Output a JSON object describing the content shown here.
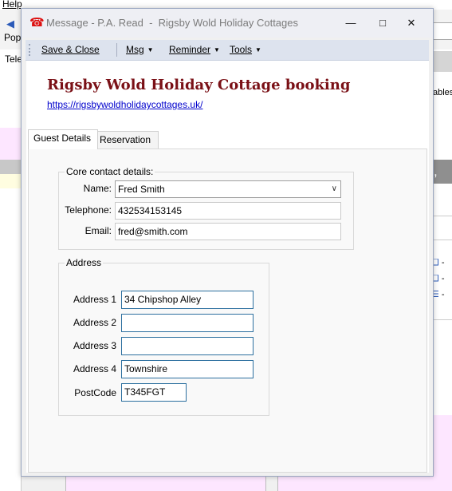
{
  "background": {
    "menu_help": "Help",
    "ribbon_label": "Pop",
    "left_tab": "Tele",
    "right_text": "ables",
    "right_header": ", wh",
    "right_dash": "-"
  },
  "window": {
    "title": "Message - P.A. Read  -  Rigsby Wold Holiday Cottages",
    "minimize": "—",
    "maximize": "□",
    "close": "✕"
  },
  "toolbar": {
    "save_close": "Save & Close",
    "msg": "Msg",
    "reminder": "Reminder",
    "tools": "Tools"
  },
  "form": {
    "heading": "Rigsby Wold Holiday Cottage booking",
    "link": "https://rigsbywoldholidaycottages.uk/",
    "tabs": [
      "Guest Details",
      "Reservation"
    ],
    "contact": {
      "legend": "Core contact details:",
      "name_label": "Name:",
      "name_value": "Fred Smith",
      "telephone_label": "Telephone:",
      "telephone_value": "432534153145",
      "email_label": "Email:",
      "email_value": "fred@smith.com"
    },
    "address": {
      "legend": "Address",
      "rows": [
        {
          "label": "Address 1",
          "value": "34 Chipshop Alley"
        },
        {
          "label": "Address 2",
          "value": ""
        },
        {
          "label": "Address 3",
          "value": ""
        },
        {
          "label": "Address 4",
          "value": "Townshire"
        }
      ],
      "postcode_label": "PostCode",
      "postcode_value": "T345FGT"
    }
  },
  "colors": {
    "heading": "#7a1016",
    "link": "#0000cc",
    "field_border": "#2c6f9f",
    "toolbar": "#dde3ee"
  }
}
